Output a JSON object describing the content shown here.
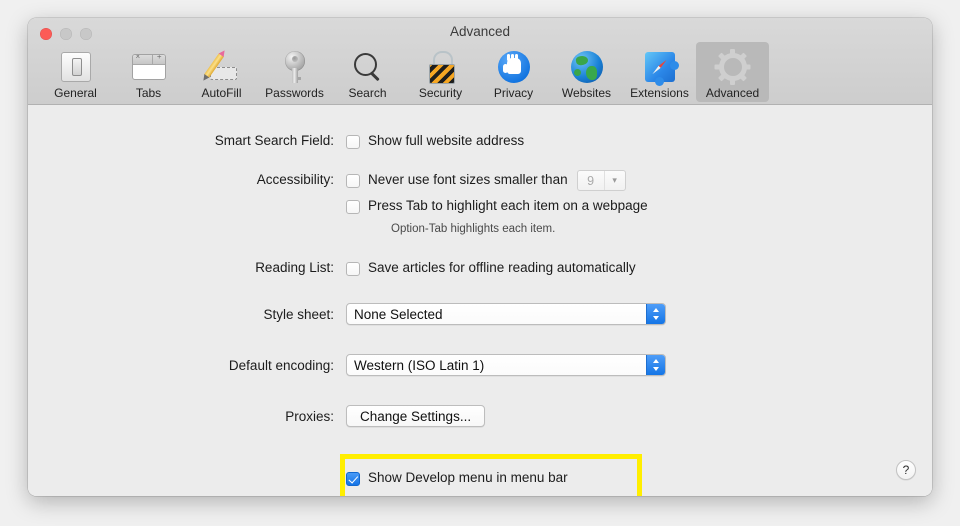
{
  "window": {
    "title": "Advanced",
    "traffic_lights": [
      "close",
      "minimize",
      "zoom"
    ]
  },
  "toolbar": {
    "items": [
      {
        "label": "General",
        "icon": "general-icon",
        "selected": false
      },
      {
        "label": "Tabs",
        "icon": "tabs-icon",
        "selected": false
      },
      {
        "label": "AutoFill",
        "icon": "autofill-icon",
        "selected": false
      },
      {
        "label": "Passwords",
        "icon": "passwords-key-icon",
        "selected": false
      },
      {
        "label": "Search",
        "icon": "search-magnifier-icon",
        "selected": false
      },
      {
        "label": "Security",
        "icon": "security-lock-icon",
        "selected": false
      },
      {
        "label": "Privacy",
        "icon": "privacy-hand-icon",
        "selected": false
      },
      {
        "label": "Websites",
        "icon": "websites-globe-icon",
        "selected": false
      },
      {
        "label": "Extensions",
        "icon": "extensions-puzzle-icon",
        "selected": false
      },
      {
        "label": "Advanced",
        "icon": "advanced-gear-icon",
        "selected": true
      }
    ]
  },
  "content": {
    "smart_search_field": {
      "label": "Smart Search Field:",
      "checkbox_label": "Show full website address",
      "checked": false
    },
    "accessibility": {
      "label": "Accessibility:",
      "font_size_checkbox_label": "Never use font sizes smaller than",
      "font_size_checked": false,
      "font_size_value": "9",
      "tab_highlight_checkbox_label": "Press Tab to highlight each item on a webpage",
      "tab_highlight_checked": false,
      "hint": "Option-Tab highlights each item."
    },
    "reading_list": {
      "label": "Reading List:",
      "checkbox_label": "Save articles for offline reading automatically",
      "checked": false
    },
    "style_sheet": {
      "label": "Style sheet:",
      "value": "None Selected"
    },
    "default_encoding": {
      "label": "Default encoding:",
      "value": "Western (ISO Latin 1)"
    },
    "proxies": {
      "label": "Proxies:",
      "button_label": "Change Settings..."
    },
    "develop_menu": {
      "checkbox_label": "Show Develop menu in menu bar",
      "checked": true,
      "highlighted": true,
      "highlight_color": "#ffee00"
    },
    "help_button_glyph": "?"
  },
  "colors": {
    "window_background": "#ececec",
    "titlebar_top": "#d9d9d9",
    "titlebar_bottom": "#cdcdcd",
    "desktop_background": "#f0f0f0",
    "accent_blue": "#1475e6",
    "highlight_yellow": "#ffee00",
    "close_red": "#fc5b57",
    "inactive_light": "#c8c8c8",
    "selected_toolbar_item": "#b9b9b9"
  }
}
